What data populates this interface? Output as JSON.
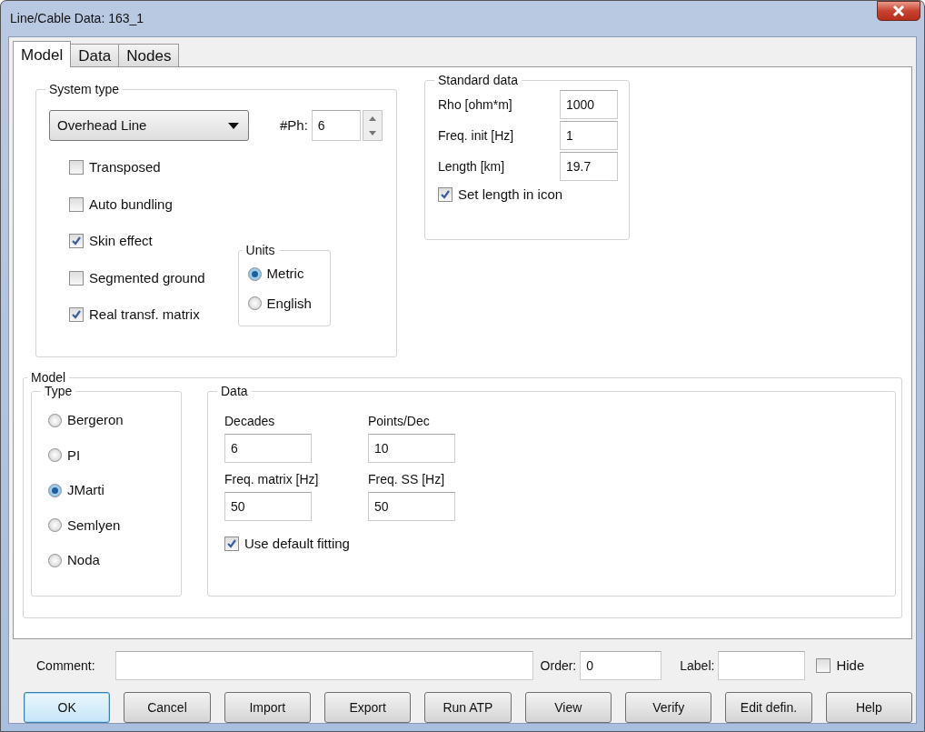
{
  "window": {
    "title": "Line/Cable Data: 163_1"
  },
  "tabs": [
    {
      "label": "Model",
      "selected": true
    },
    {
      "label": "Data",
      "selected": false
    },
    {
      "label": "Nodes",
      "selected": false
    }
  ],
  "system_type": {
    "title": "System type",
    "select": {
      "value": "Overhead Line"
    },
    "phases": {
      "label": "#Ph:",
      "value": "6"
    },
    "options": [
      {
        "label": "Transposed",
        "checked": false
      },
      {
        "label": "Auto bundling",
        "checked": false
      },
      {
        "label": "Skin effect",
        "checked": true
      },
      {
        "label": "Segmented ground",
        "checked": false
      },
      {
        "label": "Real transf. matrix",
        "checked": true
      }
    ],
    "units": {
      "title": "Units",
      "options": [
        {
          "label": "Metric",
          "selected": true
        },
        {
          "label": "English",
          "selected": false
        }
      ]
    }
  },
  "standard_data": {
    "title": "Standard data",
    "fields": [
      {
        "label": "Rho [ohm*m]",
        "value": "1000"
      },
      {
        "label": "Freq. init [Hz]",
        "value": "1"
      },
      {
        "label": "Length [km]",
        "value": "19.7"
      }
    ],
    "set_length": {
      "label": "Set length in icon",
      "checked": true
    }
  },
  "model": {
    "title": "Model",
    "type": {
      "title": "Type",
      "options": [
        {
          "label": "Bergeron",
          "selected": false
        },
        {
          "label": "PI",
          "selected": false
        },
        {
          "label": "JMarti",
          "selected": true
        },
        {
          "label": "Semlyen",
          "selected": false
        },
        {
          "label": "Noda",
          "selected": false
        }
      ]
    },
    "data": {
      "title": "Data",
      "fields": [
        {
          "label": "Decades",
          "value": "6"
        },
        {
          "label": "Points/Dec",
          "value": "10"
        },
        {
          "label": "Freq. matrix [Hz]",
          "value": "50"
        },
        {
          "label": "Freq. SS [Hz]",
          "value": "50"
        }
      ],
      "use_default": {
        "label": "Use default fitting",
        "checked": true
      }
    }
  },
  "footer": {
    "comment": {
      "label": "Comment:"
    },
    "order": {
      "label": "Order:",
      "value": "0"
    },
    "label_field": {
      "label": "Label:"
    },
    "hide": {
      "label": "Hide",
      "checked": false
    }
  },
  "buttons": [
    {
      "label": "OK",
      "default": true
    },
    {
      "label": "Cancel",
      "default": false
    },
    {
      "label": "Import",
      "default": false
    },
    {
      "label": "Export",
      "default": false
    },
    {
      "label": "Run ATP",
      "default": false
    },
    {
      "label": "View",
      "default": false
    },
    {
      "label": "Verify",
      "default": false
    },
    {
      "label": "Edit defin.",
      "default": false
    },
    {
      "label": "Help",
      "default": false
    }
  ]
}
